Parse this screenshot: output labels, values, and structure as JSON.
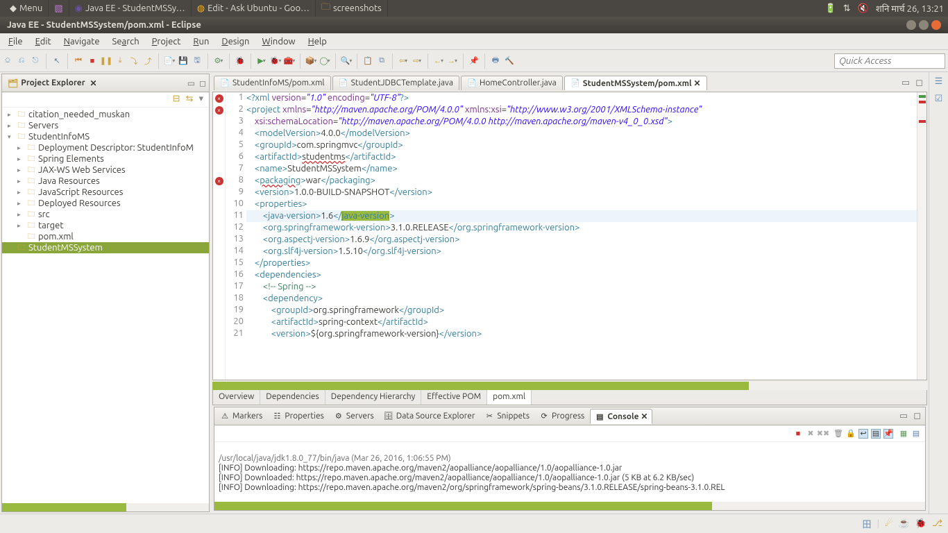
{
  "os": {
    "menu_label": "Menu",
    "tasks": [
      "Java EE - StudentMSSy…",
      "Edit - Ask Ubuntu - Goo…",
      "screenshots"
    ],
    "clock": "शनि  मार्च 26, 13:21"
  },
  "window_title": "Java EE - StudentMSSystem/pom.xml - Eclipse",
  "menubar": [
    "File",
    "Edit",
    "Navigate",
    "Search",
    "Project",
    "Run",
    "Design",
    "Window",
    "Help"
  ],
  "quick_access_placeholder": "Quick Access",
  "project_explorer": {
    "title": "Project Explorer",
    "items": [
      {
        "label": "citation_needed_muskan",
        "icon": "folder",
        "expand": "▸",
        "indent": 0
      },
      {
        "label": "Servers",
        "icon": "folder",
        "expand": "▸",
        "indent": 0
      },
      {
        "label": "StudentInfoMS",
        "icon": "web-project",
        "expand": "▾",
        "indent": 0
      },
      {
        "label": "Deployment Descriptor: StudentInfoM",
        "icon": "dd",
        "expand": "▸",
        "indent": 1
      },
      {
        "label": "Spring Elements",
        "icon": "spring",
        "expand": "▸",
        "indent": 1
      },
      {
        "label": "JAX-WS Web Services",
        "icon": "jaxws",
        "expand": "▸",
        "indent": 1
      },
      {
        "label": "Java Resources",
        "icon": "java",
        "expand": "▸",
        "indent": 1
      },
      {
        "label": "JavaScript Resources",
        "icon": "js",
        "expand": "▸",
        "indent": 1
      },
      {
        "label": "Deployed Resources",
        "icon": "deploy",
        "expand": "▸",
        "indent": 1
      },
      {
        "label": "src",
        "icon": "src",
        "expand": "▸",
        "indent": 1
      },
      {
        "label": "target",
        "icon": "folder",
        "expand": "▸",
        "indent": 1
      },
      {
        "label": "pom.xml",
        "icon": "xml",
        "expand": "",
        "indent": 1
      },
      {
        "label": "StudentMSSystem",
        "icon": "web-project",
        "expand": "",
        "indent": 0,
        "selected": true
      }
    ]
  },
  "editor_tabs": [
    {
      "label": "StudentInfoMS/pom.xml",
      "active": false
    },
    {
      "label": "StudentJDBCTemplate.java",
      "active": false
    },
    {
      "label": "HomeController.java",
      "active": false
    },
    {
      "label": "StudentMSSystem/pom.xml",
      "active": true
    }
  ],
  "code_lines": [
    {
      "n": 1,
      "err": true,
      "html": "<span class='t-tag'>&lt;?xml</span> <span class='t-attr'>version</span>=<span class='t-str'>\"1.0\"</span> <span class='t-attr'>encoding</span>=<span class='t-str'>\"UTF-8\"</span><span class='t-tag'>?&gt;</span>"
    },
    {
      "n": 2,
      "err": true,
      "html": "<span class='t-tag'>&lt;project</span> <span class='t-attr'>xmlns</span>=<span class='t-str'>\"http://maven.apache.org/POM/4.0.0\"</span> <span class='t-attr'>xmlns:xsi</span>=<span class='t-str'>\"http://www.w3.org/2001/XMLSchema-instance\"</span>"
    },
    {
      "n": 3,
      "html": "    <span class='t-attr'>xsi:schemaLocation</span>=<span class='t-str'>\"http://maven.apache.org/POM/4.0.0 http://maven.apache.org/maven-v4_0_0.xsd\"</span><span class='t-tag'>&gt;</span>"
    },
    {
      "n": 4,
      "html": "    <span class='t-tag'>&lt;modelVersion&gt;</span>4.0.0<span class='t-tag'>&lt;/modelVersion&gt;</span>"
    },
    {
      "n": 5,
      "html": "    <span class='t-tag'>&lt;groupId&gt;</span>com.springmvc<span class='t-tag'>&lt;/groupId&gt;</span>"
    },
    {
      "n": 6,
      "html": "    <span class='t-tag'>&lt;artifactId&gt;</span><span class='t-err'>studentms</span><span class='t-tag'>&lt;/artifactId&gt;</span>"
    },
    {
      "n": 7,
      "html": "    <span class='t-tag'>&lt;name&gt;</span>StudentMSSystem<span class='t-tag'>&lt;/name&gt;</span>"
    },
    {
      "n": 8,
      "err": true,
      "html": "    <span class='t-tag'>&lt;<span class='t-err'>packaging</span>&gt;</span>war<span class='t-tag'>&lt;/packaging&gt;</span>"
    },
    {
      "n": 9,
      "html": "    <span class='t-tag'>&lt;version&gt;</span>1.0.0-BUILD-SNAPSHOT<span class='t-tag'>&lt;/version&gt;</span>"
    },
    {
      "n": 10,
      "html": "    <span class='t-tag'>&lt;properties&gt;</span>"
    },
    {
      "n": 11,
      "hl": true,
      "html": "        <span class='t-tag'>&lt;java-version&gt;</span>1.6<span class='t-tag'>&lt;/</span><span class='sel t-tag'>java-version</span><span class='t-tag'>&gt;</span>"
    },
    {
      "n": 12,
      "html": "        <span class='t-tag'>&lt;org.springframework-version&gt;</span>3.1.0.RELEASE<span class='t-tag'>&lt;/org.springframework-version&gt;</span>"
    },
    {
      "n": 13,
      "html": "        <span class='t-tag'>&lt;org.aspectj-version&gt;</span>1.6.9<span class='t-tag'>&lt;/org.aspectj-version&gt;</span>"
    },
    {
      "n": 14,
      "html": "        <span class='t-tag'>&lt;org.slf4j-version&gt;</span>1.5.10<span class='t-tag'>&lt;/org.slf4j-version&gt;</span>"
    },
    {
      "n": 15,
      "html": "    <span class='t-tag'>&lt;/properties&gt;</span>"
    },
    {
      "n": 16,
      "html": "    <span class='t-tag'>&lt;dependencies&gt;</span>"
    },
    {
      "n": 17,
      "html": "        <span class='t-cmt'>&lt;!-- Spring --&gt;</span>"
    },
    {
      "n": 18,
      "html": "        <span class='t-tag'>&lt;dependency&gt;</span>"
    },
    {
      "n": 19,
      "html": "            <span class='t-tag'>&lt;groupId&gt;</span>org.springframework<span class='t-tag'>&lt;/groupId&gt;</span>"
    },
    {
      "n": 20,
      "html": "            <span class='t-tag'>&lt;artifactId&gt;</span>spring-context<span class='t-tag'>&lt;/artifactId&gt;</span>"
    },
    {
      "n": 21,
      "html": "            <span class='t-tag'>&lt;version&gt;</span>${org.springframework-version}<span class='t-tag'>&lt;/version&gt;</span>"
    }
  ],
  "pom_tabs": [
    "Overview",
    "Dependencies",
    "Dependency Hierarchy",
    "Effective POM",
    "pom.xml"
  ],
  "pom_tab_active": 4,
  "bottom_tabs": [
    "Markers",
    "Properties",
    "Servers",
    "Data Source Explorer",
    "Snippets",
    "Progress",
    "Console"
  ],
  "bottom_tab_active": 6,
  "console": {
    "header": "/usr/local/java/jdk1.8.0_77/bin/java (Mar 26, 2016, 1:06:55 PM)",
    "lines": [
      "[INFO] Downloading: https://repo.maven.apache.org/maven2/aopalliance/aopalliance/1.0/aopalliance-1.0.jar",
      "[INFO] Downloaded: https://repo.maven.apache.org/maven2/aopalliance/aopalliance/1.0/aopalliance-1.0.jar (5 KB at 6.2 KB/sec)",
      "[INFO] Downloading: https://repo.maven.apache.org/maven2/org/springframework/spring-beans/3.1.0.RELEASE/spring-beans-3.1.0.REL"
    ]
  }
}
